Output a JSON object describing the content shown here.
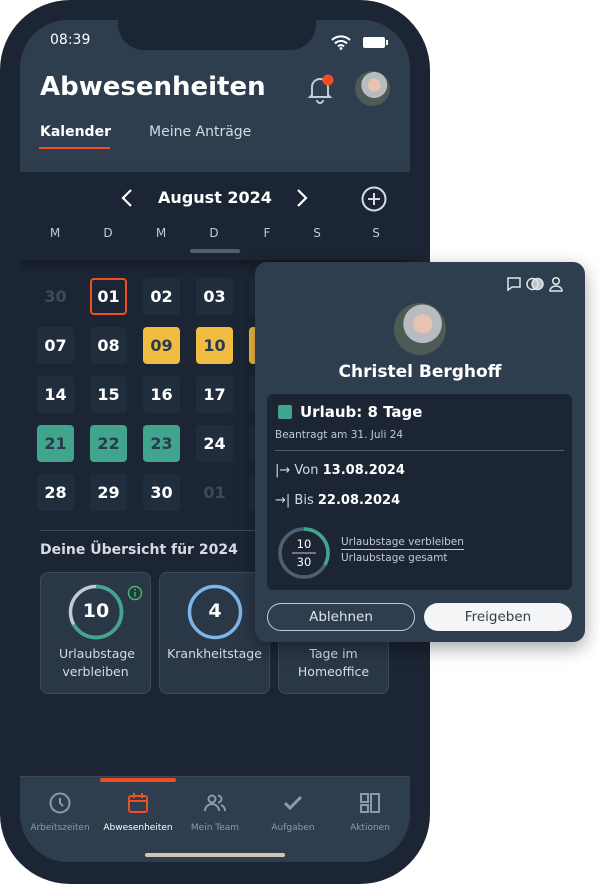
{
  "status": {
    "time": "08:39"
  },
  "header": {
    "title": "Abwesenheiten",
    "tabs": [
      {
        "label": "Kalender"
      },
      {
        "label": "Meine Anträge"
      }
    ]
  },
  "calendar": {
    "month": "August 2024",
    "weekdays": [
      "M",
      "D",
      "M",
      "D",
      "F",
      "S",
      "S"
    ],
    "rows": [
      [
        {
          "d": "30",
          "t": "muted"
        },
        {
          "d": "01",
          "t": "today"
        },
        {
          "d": "02",
          "t": ""
        },
        {
          "d": "03",
          "t": ""
        }
      ],
      [
        {
          "d": "07",
          "t": ""
        },
        {
          "d": "08",
          "t": ""
        },
        {
          "d": "09",
          "t": "yellow"
        },
        {
          "d": "10",
          "t": "yellow"
        }
      ],
      [
        {
          "d": "14",
          "t": ""
        },
        {
          "d": "15",
          "t": ""
        },
        {
          "d": "16",
          "t": ""
        },
        {
          "d": "17",
          "t": ""
        }
      ],
      [
        {
          "d": "21",
          "t": "green"
        },
        {
          "d": "22",
          "t": "green"
        },
        {
          "d": "23",
          "t": "green"
        },
        {
          "d": "24",
          "t": ""
        }
      ],
      [
        {
          "d": "28",
          "t": ""
        },
        {
          "d": "29",
          "t": ""
        },
        {
          "d": "30",
          "t": ""
        },
        {
          "d": "01",
          "t": "muted"
        }
      ]
    ]
  },
  "overview": {
    "title": "Deine Übersicht für 2024",
    "cards": [
      {
        "value": "10",
        "label": "Urlaubstage verbleiben",
        "fraction": 0.67,
        "color": "#41a58d"
      },
      {
        "value": "4",
        "label": "Krankheitstage",
        "fraction": 1,
        "color": "#7fb4e6"
      },
      {
        "value": "",
        "label": "Tage im Homeoffice"
      }
    ]
  },
  "nav": {
    "items": [
      {
        "label": "Arbeitszeiten"
      },
      {
        "label": "Abwesenheiten"
      },
      {
        "label": "Mein Team"
      },
      {
        "label": "Aufgaben"
      },
      {
        "label": "Aktionen"
      }
    ],
    "active": 1
  },
  "popup": {
    "name": "Christel Berghoff",
    "type": "Urlaub: 8 Tage",
    "requested": "Beantragt am 31. Juli 24",
    "from_label": "Von",
    "from": "13.08.2024",
    "to_label": "Bis",
    "to": "22.08.2024",
    "remaining": "10",
    "total": "30",
    "remaining_label": "Urlaubstage verbleiben",
    "total_label": "Urlaubstage gesamt",
    "reject": "Ablehnen",
    "approve": "Freigeben"
  },
  "colors": {
    "accent": "#f04e23",
    "vacation": "#41a58d",
    "holiday": "#f0bc42",
    "sick": "#7fb4e6"
  }
}
